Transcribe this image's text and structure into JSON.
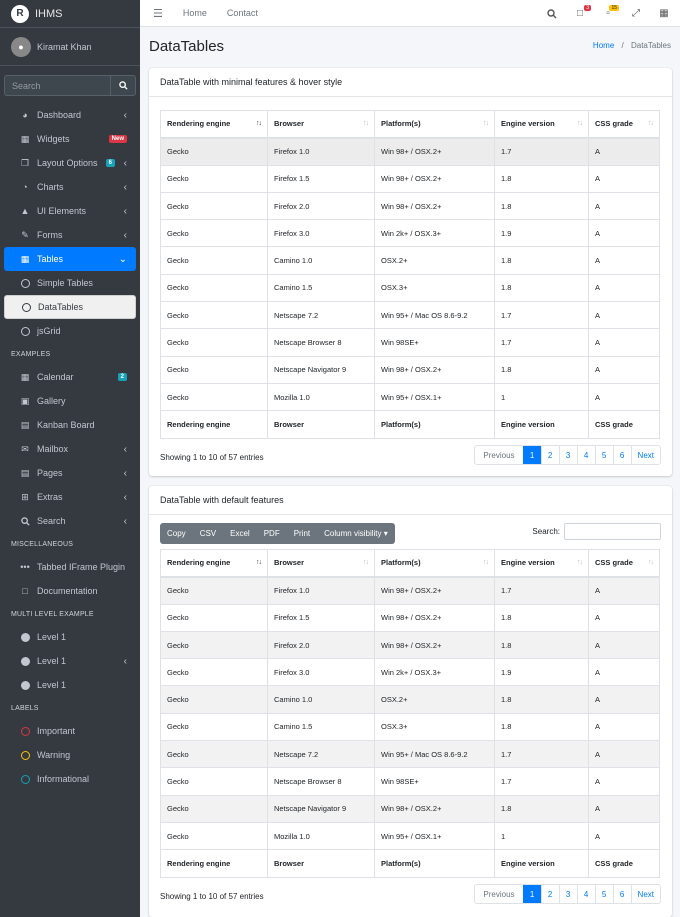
{
  "brand": {
    "name": "IHMS",
    "logo_letter": "R"
  },
  "user": {
    "name": "Kiramat Khan"
  },
  "sidebar_search": {
    "placeholder": "Search"
  },
  "nav": {
    "dashboard": "Dashboard",
    "widgets": "Widgets",
    "widgets_badge": "New",
    "layout": "Layout Options",
    "layout_badge": "6",
    "charts": "Charts",
    "ui": "UI Elements",
    "forms": "Forms",
    "tables": "Tables",
    "simple_tables": "Simple Tables",
    "datatables": "DataTables",
    "jsgrid": "jsGrid",
    "examples_header": "EXAMPLES",
    "calendar": "Calendar",
    "calendar_badge": "2",
    "gallery": "Gallery",
    "kanban": "Kanban Board",
    "mailbox": "Mailbox",
    "pages": "Pages",
    "extras": "Extras",
    "search": "Search",
    "misc_header": "MISCELLANEOUS",
    "tabbed": "Tabbed IFrame Plugin",
    "documentation": "Documentation",
    "multi_header": "MULTI LEVEL EXAMPLE",
    "level1a": "Level 1",
    "level1b": "Level 1",
    "level1c": "Level 1",
    "labels_header": "LABELS",
    "important": "Important",
    "warning": "Warning",
    "informational": "Informational"
  },
  "topbar": {
    "home": "Home",
    "contact": "Contact",
    "messages_badge": "3",
    "notifications_badge": "15"
  },
  "page": {
    "title": "DataTables",
    "crumb_home": "Home",
    "crumb_sep": "/",
    "crumb_current": "DataTables"
  },
  "card1": {
    "title": "DataTable with minimal features & hover style",
    "info": "Showing 1 to 10 of 57 entries"
  },
  "card2": {
    "title": "DataTable with default features",
    "info": "Showing 1 to 10 of 57 entries",
    "search_label": "Search:",
    "buttons": [
      "Copy",
      "CSV",
      "Excel",
      "PDF",
      "Print",
      "Column visibility ▾"
    ]
  },
  "columns": [
    "Rendering engine",
    "Browser",
    "Platform(s)",
    "Engine version",
    "CSS grade"
  ],
  "rows": [
    [
      "Gecko",
      "Firefox 1.0",
      "Win 98+ / OSX.2+",
      "1.7",
      "A"
    ],
    [
      "Gecko",
      "Firefox 1.5",
      "Win 98+ / OSX.2+",
      "1.8",
      "A"
    ],
    [
      "Gecko",
      "Firefox 2.0",
      "Win 98+ / OSX.2+",
      "1.8",
      "A"
    ],
    [
      "Gecko",
      "Firefox 3.0",
      "Win 2k+ / OSX.3+",
      "1.9",
      "A"
    ],
    [
      "Gecko",
      "Camino 1.0",
      "OSX.2+",
      "1.8",
      "A"
    ],
    [
      "Gecko",
      "Camino 1.5",
      "OSX.3+",
      "1.8",
      "A"
    ],
    [
      "Gecko",
      "Netscape 7.2",
      "Win 95+ / Mac OS 8.6-9.2",
      "1.7",
      "A"
    ],
    [
      "Gecko",
      "Netscape Browser 8",
      "Win 98SE+",
      "1.7",
      "A"
    ],
    [
      "Gecko",
      "Netscape Navigator 9",
      "Win 98+ / OSX.2+",
      "1.8",
      "A"
    ],
    [
      "Gecko",
      "Mozilla 1.0",
      "Win 95+ / OSX.1+",
      "1",
      "A"
    ]
  ],
  "pager": [
    "Previous",
    "1",
    "2",
    "3",
    "4",
    "5",
    "6",
    "Next"
  ],
  "colors": {
    "primary": "#007bff",
    "sidebar": "#343a40",
    "important": "#dc3545",
    "warning": "#ffc107",
    "info": "#17a2b8"
  }
}
